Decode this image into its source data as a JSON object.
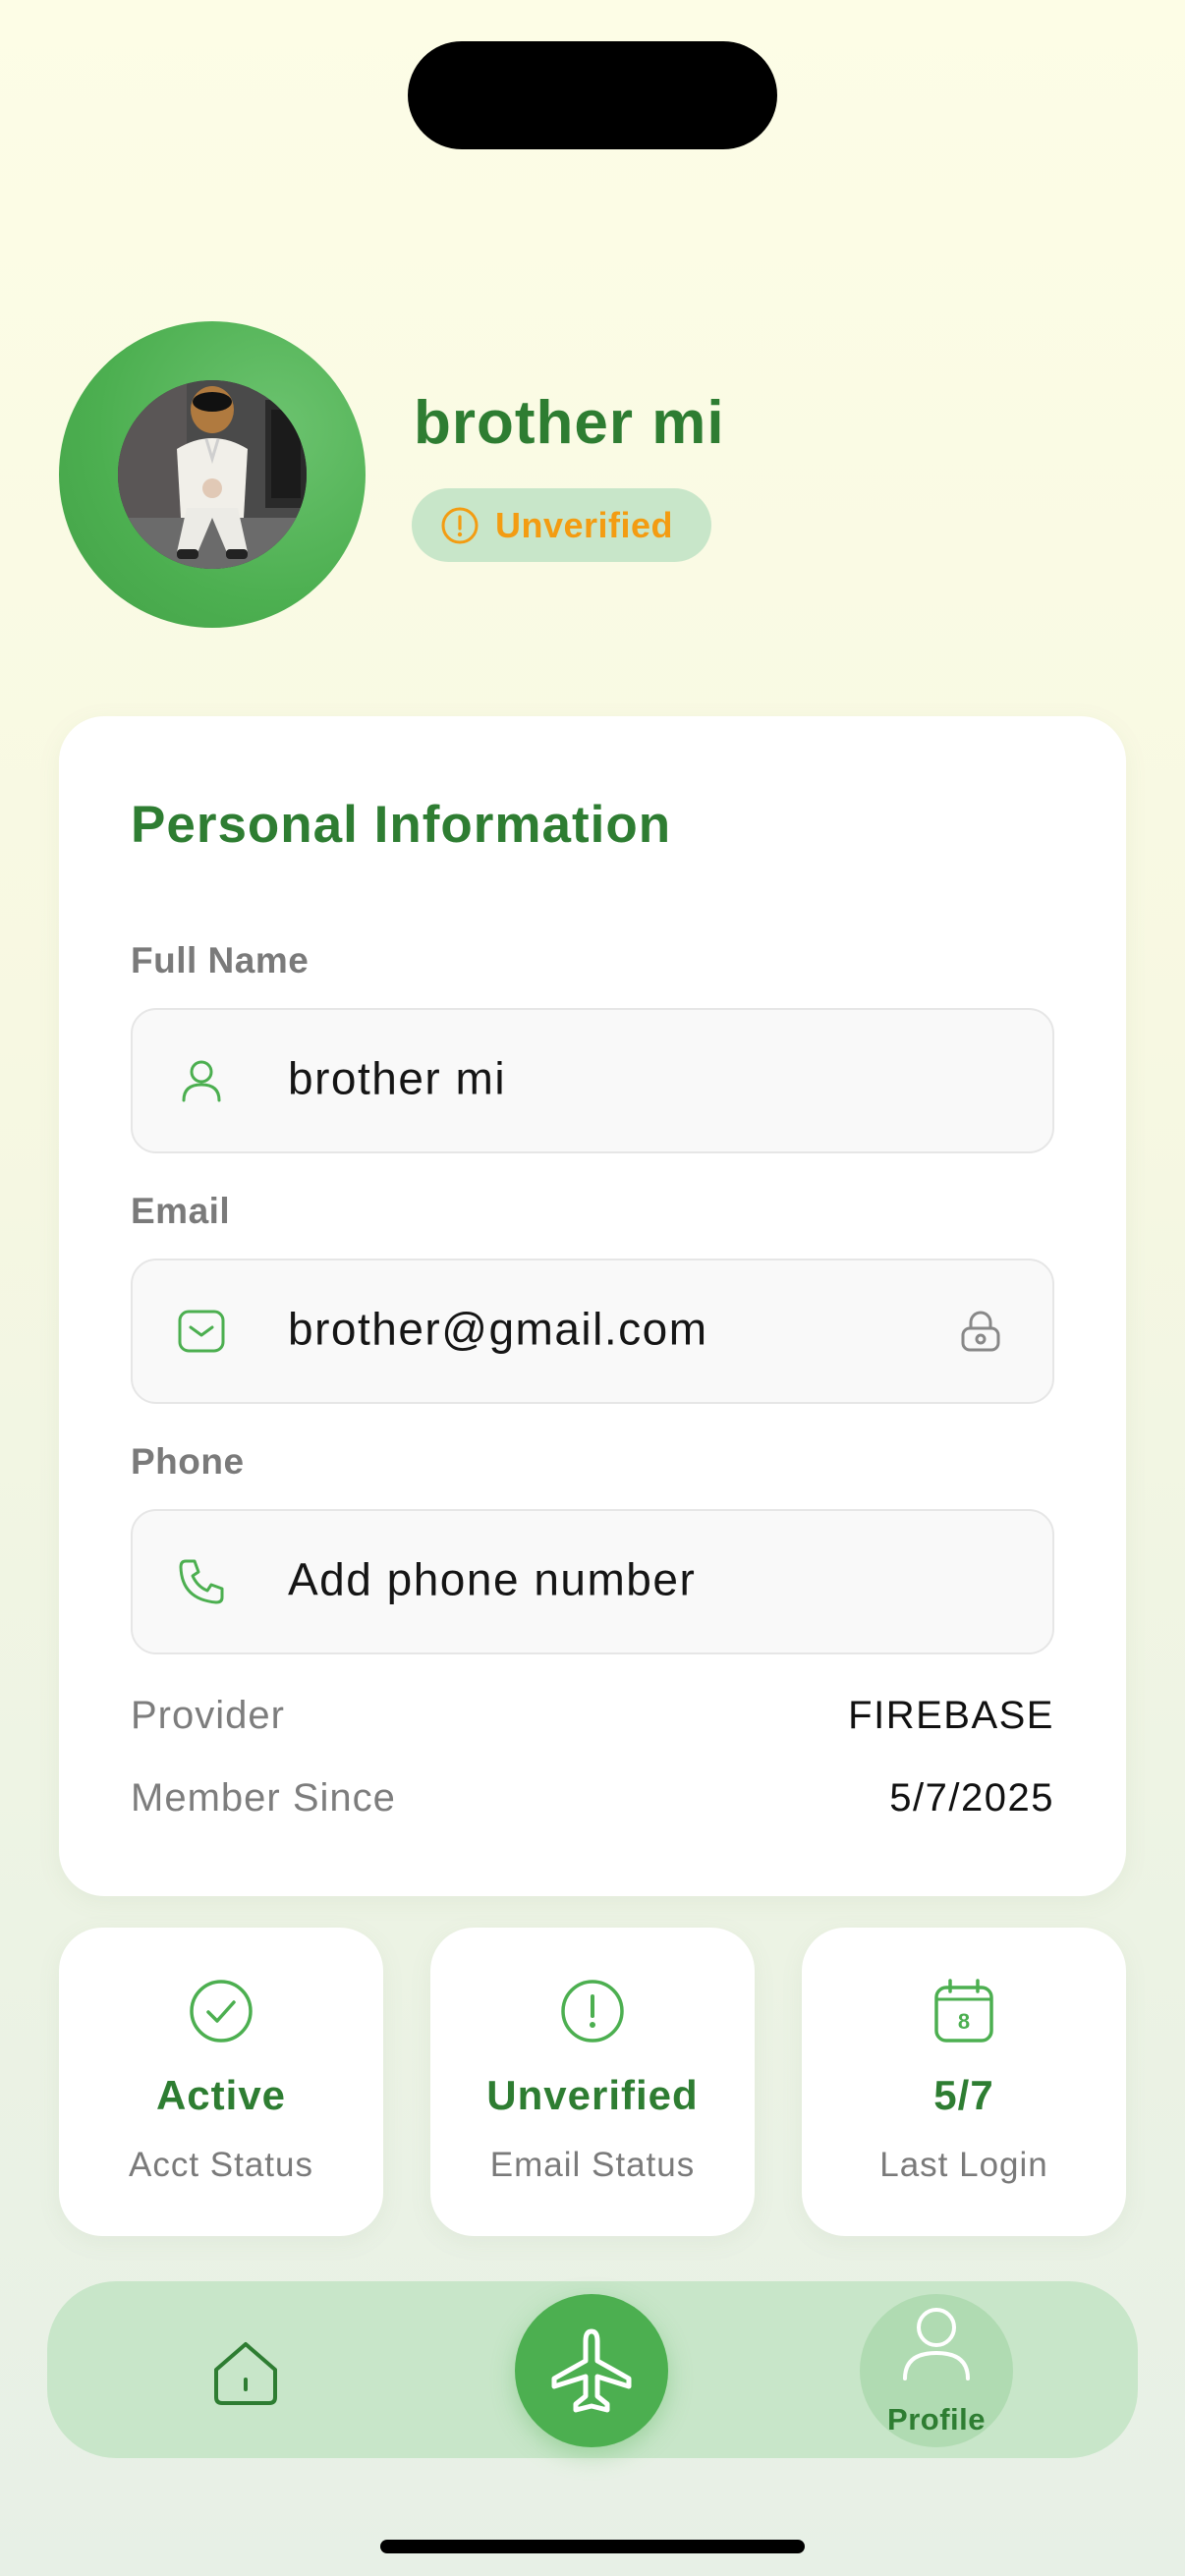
{
  "profile": {
    "name": "brother mi",
    "verification_badge": "Unverified"
  },
  "personal_info": {
    "title": "Personal Information",
    "full_name_label": "Full Name",
    "full_name_value": "brother mi",
    "email_label": "Email",
    "email_value": "brother@gmail.com",
    "phone_label": "Phone",
    "phone_placeholder": "Add phone number",
    "provider_label": "Provider",
    "provider_value": "FIREBASE",
    "member_since_label": "Member Since",
    "member_since_value": "5/7/2025"
  },
  "stats": [
    {
      "value": "Active",
      "label": "Acct Status",
      "icon": "check-circle-icon"
    },
    {
      "value": "Unverified",
      "label": "Email Status",
      "icon": "alert-circle-icon"
    },
    {
      "value": "5/7",
      "label": "Last Login",
      "icon": "calendar-icon",
      "icon_text": "8"
    }
  ],
  "nav": {
    "home_icon": "home-icon",
    "center_icon": "airplane-icon",
    "profile_label": "Profile"
  },
  "colors": {
    "primary_green": "#2e7d32",
    "accent_green": "#4caf50",
    "light_green": "#c8e6c9",
    "warning_orange": "#f39c12"
  }
}
